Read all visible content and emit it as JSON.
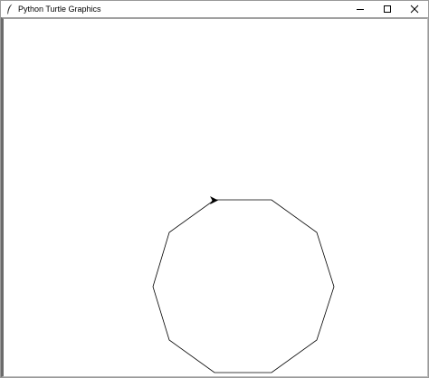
{
  "window": {
    "title": "Python Turtle Graphics",
    "icon": "feather-icon",
    "controls": {
      "minimize_icon": "minimize-icon",
      "maximize_icon": "maximize-icon",
      "close_icon": "close-icon"
    }
  },
  "canvas": {
    "background": "#ffffff",
    "shape": "decagon",
    "sides": 10,
    "pen_color": "#000000",
    "turtle_icon": "turtle-arrow-icon",
    "turtle_heading": "east"
  }
}
